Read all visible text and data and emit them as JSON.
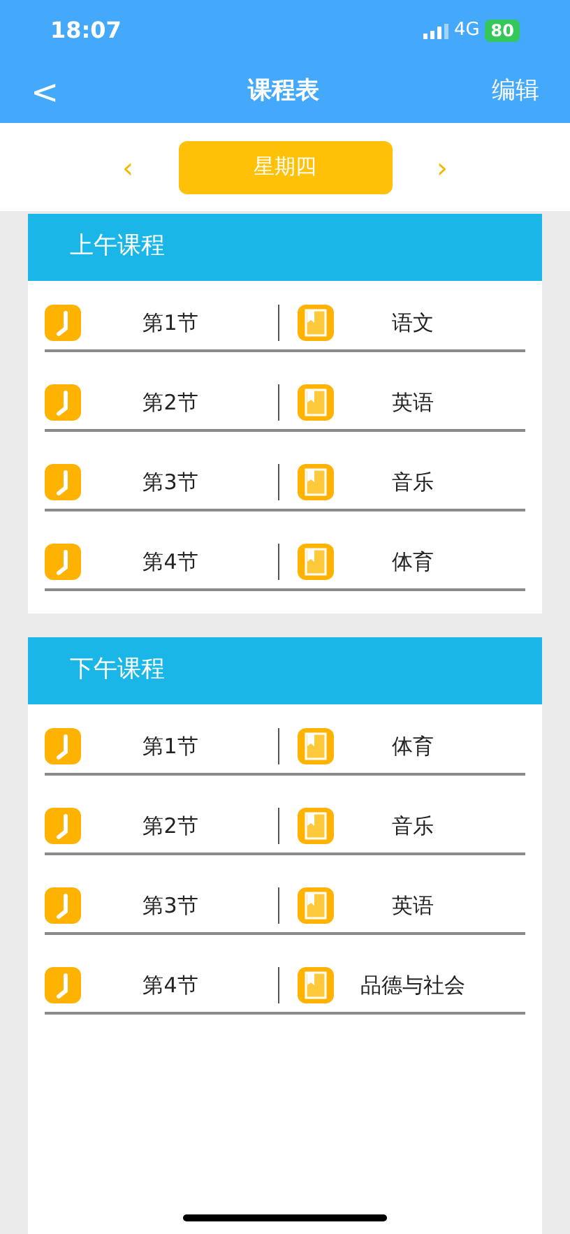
{
  "status_bar": {
    "time": "18:07",
    "network": "4G",
    "battery": "80"
  },
  "nav": {
    "back": "<",
    "title": "课程表",
    "action": "编辑"
  },
  "day_selector": {
    "prev": "‹",
    "day": "星期四",
    "next": "›"
  },
  "sections": [
    {
      "title": "上午课程",
      "lessons": [
        {
          "period": "第1节",
          "subject": "语文"
        },
        {
          "period": "第2节",
          "subject": "英语"
        },
        {
          "period": "第3节",
          "subject": "音乐"
        },
        {
          "period": "第4节",
          "subject": "体育"
        }
      ]
    },
    {
      "title": "下午课程",
      "lessons": [
        {
          "period": "第1节",
          "subject": "体育"
        },
        {
          "period": "第2节",
          "subject": "音乐"
        },
        {
          "period": "第3节",
          "subject": "英语"
        },
        {
          "period": "第4节",
          "subject": "品德与社会"
        }
      ]
    }
  ]
}
